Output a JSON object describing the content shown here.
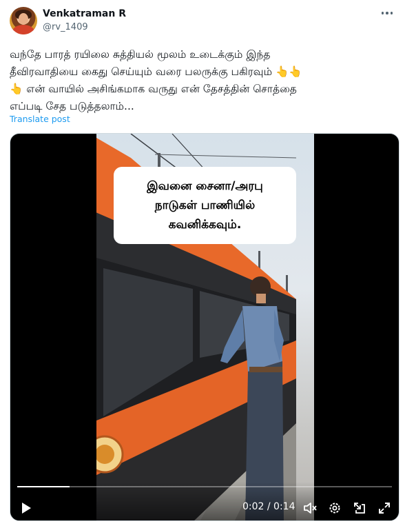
{
  "author": {
    "name": "Venkatraman R",
    "handle": "@rv_1409"
  },
  "tweet": {
    "lines": [
      "வந்தே பாரத் ரயிலை சுத்தியல் மூலம் உடைக்கும் இந்த",
      "தீவிரவாதியை கைது செய்யும் வரை பலருக்கு பகிரவும் 👆👆",
      "👆 என் வாயில் அசிங்கமாக வருது என் தேசத்தின் சொத்தை",
      "எப்படி சேத படுத்தலாம்..."
    ],
    "translate_label": "Translate post"
  },
  "video": {
    "caption_lines": [
      "இவனை சைனா/அரபு",
      "நாடுகள் பாணியில்",
      "கவனிக்கவும்."
    ],
    "time_display": "0:02 / 0:14",
    "progress_fraction": 0.14,
    "icons": [
      "play-icon",
      "mute-icon",
      "settings-icon",
      "minimize-icon",
      "fullscreen-icon"
    ]
  },
  "colors": {
    "link": "#1d9bf0",
    "train_orange": "#e8692a"
  }
}
